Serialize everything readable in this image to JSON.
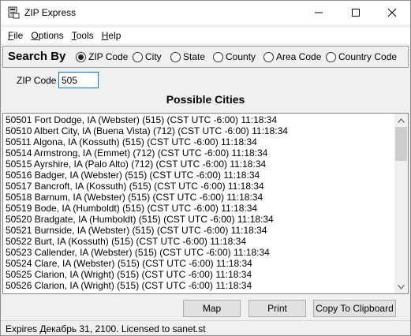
{
  "window": {
    "title": "ZIP Express"
  },
  "menu": {
    "items": [
      {
        "label": "File",
        "accel": "F",
        "rest": "ile"
      },
      {
        "label": "Options",
        "accel": "O",
        "rest": "ptions"
      },
      {
        "label": "Tools",
        "accel": "T",
        "rest": "ools"
      },
      {
        "label": "Help",
        "accel": "H",
        "rest": "elp"
      }
    ]
  },
  "search_by": {
    "label": "Search By",
    "options": [
      {
        "label": "ZIP Code",
        "selected": true
      },
      {
        "label": "City",
        "selected": false
      },
      {
        "label": "State",
        "selected": false
      },
      {
        "label": "County",
        "selected": false
      },
      {
        "label": "Area Code",
        "selected": false
      },
      {
        "label": "Country Code",
        "selected": false
      }
    ]
  },
  "zip": {
    "label": "ZIP Code",
    "value": "505"
  },
  "results": {
    "title": "Possible Cities",
    "rows": [
      "50501 Fort Dodge, IA (Webster) (515) (CST  UTC -6:00) 11:18:34",
      "50510 Albert City, IA (Buena Vista) (712) (CST  UTC -6:00) 11:18:34",
      "50511 Algona, IA (Kossuth) (515) (CST  UTC -6:00) 11:18:34",
      "50514 Armstrong, IA (Emmet) (712) (CST  UTC -6:00) 11:18:34",
      "50515 Ayrshire, IA (Palo Alto) (712) (CST  UTC -6:00) 11:18:34",
      "50516 Badger, IA (Webster) (515) (CST  UTC -6:00) 11:18:34",
      "50517 Bancroft, IA (Kossuth) (515) (CST  UTC -6:00) 11:18:34",
      "50518 Barnum, IA (Webster) (515) (CST  UTC -6:00) 11:18:34",
      "50519 Bode, IA (Humboldt) (515) (CST  UTC -6:00) 11:18:34",
      "50520 Bradgate, IA (Humboldt) (515) (CST  UTC -6:00) 11:18:34",
      "50521 Burnside, IA (Webster) (515) (CST  UTC -6:00) 11:18:34",
      "50522 Burt, IA (Kossuth) (515) (CST  UTC -6:00) 11:18:34",
      "50523 Callender, IA (Webster) (515) (CST  UTC -6:00) 11:18:34",
      "50524 Clare, IA (Webster) (515) (CST  UTC -6:00) 11:18:34",
      "50525 Clarion, IA (Wright) (515) (CST  UTC -6:00) 11:18:34",
      "50526 Clarion, IA (Wright) (515) (CST  UTC -6:00) 11:18:34"
    ]
  },
  "buttons": {
    "map": "Map",
    "print": "Print",
    "clipboard": "Copy To Clipboard"
  },
  "status": {
    "text": "Expires Декабрь 31, 2100. Licensed to sanet.st"
  }
}
